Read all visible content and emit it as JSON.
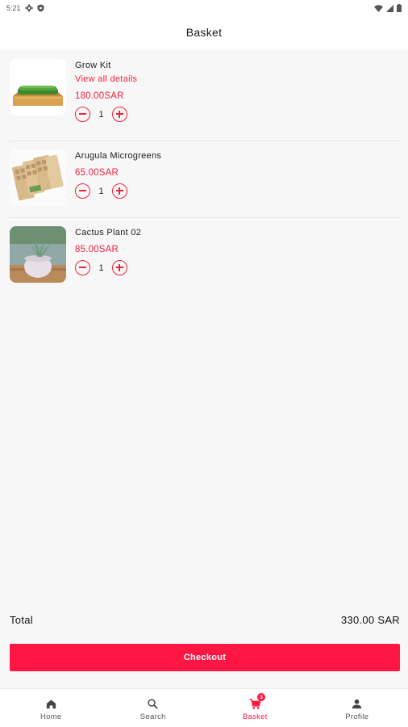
{
  "status_bar": {
    "time": "5:21"
  },
  "header": {
    "title": "Basket"
  },
  "items": [
    {
      "name": "Grow Kit",
      "details_label": "View all details",
      "price": "180.00SAR",
      "quantity": "1"
    },
    {
      "name": "Arugula Microgreens",
      "price": "65.00SAR",
      "quantity": "1"
    },
    {
      "name": "Cactus Plant 02",
      "price": "85.00SAR",
      "quantity": "1"
    }
  ],
  "summary": {
    "total_label": "Total",
    "total_value": "330.00 SAR"
  },
  "checkout_label": "Checkout",
  "nav": {
    "items": [
      {
        "label": "Home",
        "icon": "home-icon"
      },
      {
        "label": "Search",
        "icon": "search-icon"
      },
      {
        "label": "Basket",
        "icon": "cart-icon",
        "badge": "3"
      },
      {
        "label": "Profile",
        "icon": "person-icon"
      }
    ],
    "active": "Basket"
  },
  "colors": {
    "accent": "#ff1744",
    "price": "#f0233f",
    "background": "#f7f7f7",
    "surface": "#ffffff"
  }
}
